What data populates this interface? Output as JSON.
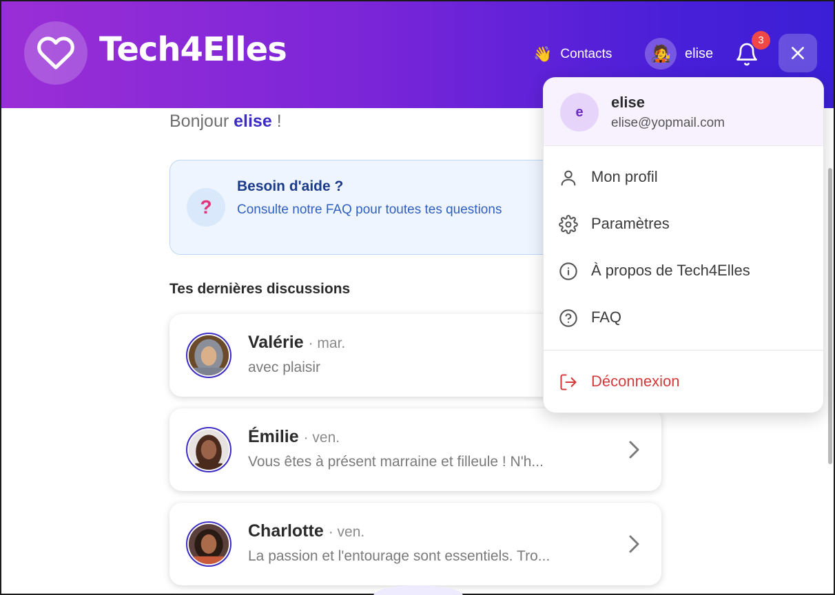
{
  "header": {
    "brand": "Tech4Elles",
    "contacts_label": "Contacts",
    "contacts_emoji": "👋",
    "user_name": "elise",
    "user_emoji": "🧑‍🎤",
    "notification_count": "3",
    "gradient_start": "#9a2ed6",
    "gradient_end": "#3a1fd6"
  },
  "main": {
    "greeting_prefix": "Bonjour",
    "greeting_name": "elise",
    "greeting_suffix": "!",
    "help": {
      "title": "Besoin d'aide ?",
      "text": "Consulte notre FAQ pour toutes tes questions",
      "icon": "?"
    },
    "section_title": "Tes dernières discussions",
    "conversations": [
      {
        "name": "Valérie",
        "day": "· mar.",
        "message": "avec plaisir"
      },
      {
        "name": "Émilie",
        "day": "· ven.",
        "message": "Vous êtes à présent marraine et filleule ! N'h..."
      },
      {
        "name": "Charlotte",
        "day": "· ven.",
        "message": "La passion et l'entourage sont essentiels. Tro..."
      }
    ]
  },
  "dropdown": {
    "avatar_letter": "e",
    "name": "elise",
    "email": "elise@yopmail.com",
    "items": [
      {
        "label": "Mon profil",
        "icon": "user-icon"
      },
      {
        "label": "Paramètres",
        "icon": "gear-icon"
      },
      {
        "label": "À propos de Tech4Elles",
        "icon": "info-icon"
      },
      {
        "label": "FAQ",
        "icon": "question-icon"
      }
    ],
    "logout_label": "Déconnexion",
    "logout_color": "#d43a3a"
  }
}
